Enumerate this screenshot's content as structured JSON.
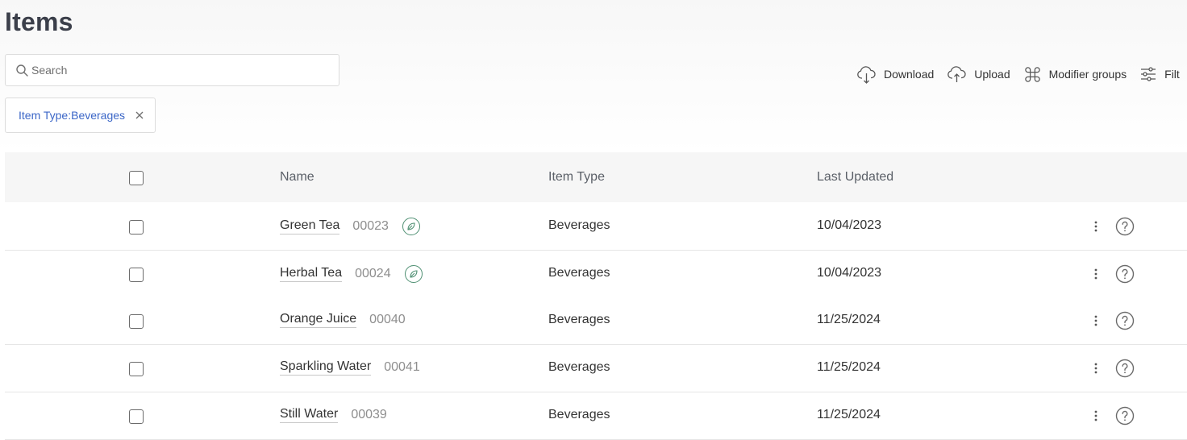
{
  "page": {
    "title": "Items"
  },
  "search": {
    "placeholder": "Search"
  },
  "toolbar": {
    "download_label": "Download",
    "upload_label": "Upload",
    "modifier_groups_label": "Modifier groups",
    "filter_label": "Filt"
  },
  "filter_chip": {
    "label": "Item Type:Beverages"
  },
  "table": {
    "columns": {
      "name": "Name",
      "item_type": "Item Type",
      "last_updated": "Last Updated"
    },
    "rows": [
      {
        "name": "Green Tea",
        "code": "00023",
        "badge": "leaf-icon",
        "item_type": "Beverages",
        "last_updated": "10/04/2023"
      },
      {
        "name": "Herbal Tea",
        "code": "00024",
        "badge": "leaf-icon",
        "item_type": "Beverages",
        "last_updated": "10/04/2023"
      },
      {
        "name": "Orange Juice",
        "code": "00040",
        "badge": "",
        "item_type": "Beverages",
        "last_updated": "11/25/2024"
      },
      {
        "name": "Sparkling Water",
        "code": "00041",
        "badge": "",
        "item_type": "Beverages",
        "last_updated": "11/25/2024"
      },
      {
        "name": "Still Water",
        "code": "00039",
        "badge": "",
        "item_type": "Beverages",
        "last_updated": "11/25/2024"
      }
    ]
  },
  "colors": {
    "chip_text": "#3b66c7",
    "leaf_badge": "#4e8f72",
    "header_bg": "#f6f6f6"
  }
}
